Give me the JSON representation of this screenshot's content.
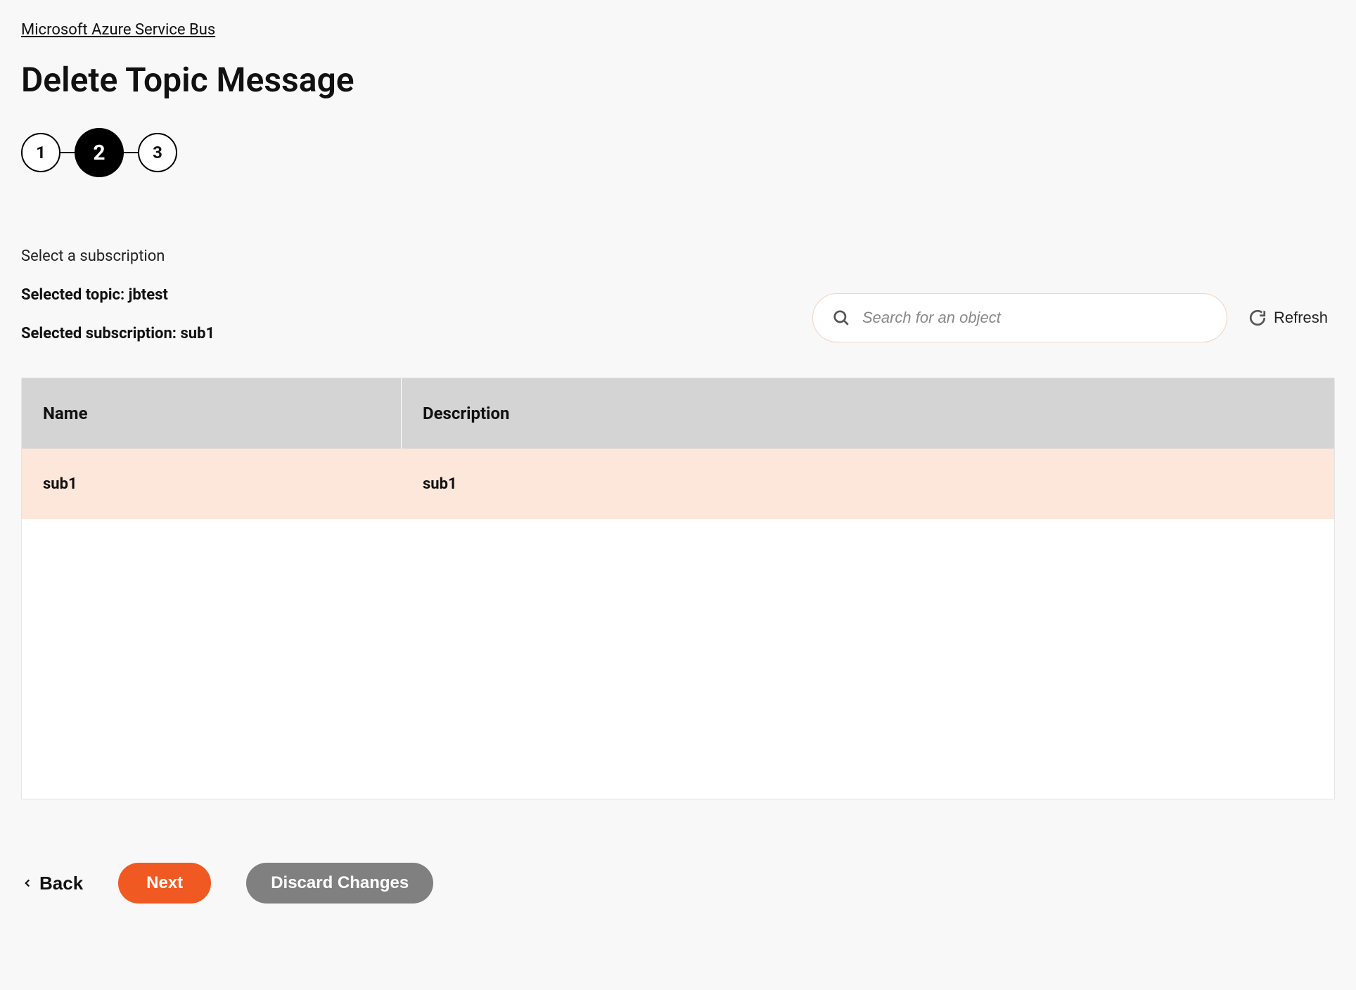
{
  "breadcrumb": "Microsoft Azure Service Bus",
  "page_title": "Delete Topic Message",
  "steps": [
    "1",
    "2",
    "3"
  ],
  "current_step_index": 1,
  "instruction": "Select a subscription",
  "selected_topic_label": "Selected topic: jbtest",
  "selected_subscription_label": "Selected subscription: sub1",
  "search": {
    "placeholder": "Search for an object",
    "value": ""
  },
  "refresh_label": "Refresh",
  "table": {
    "headers": {
      "name": "Name",
      "description": "Description"
    },
    "rows": [
      {
        "name": "sub1",
        "description": "sub1",
        "selected": true
      }
    ]
  },
  "actions": {
    "back": "Back",
    "next": "Next",
    "discard": "Discard Changes"
  }
}
